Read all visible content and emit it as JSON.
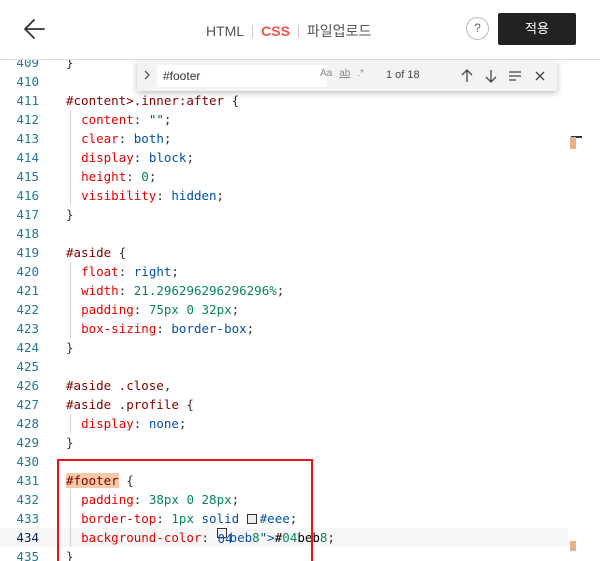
{
  "header": {
    "tabs": [
      {
        "label": "HTML",
        "active": false
      },
      {
        "label": "CSS",
        "active": true
      },
      {
        "label": "파일업로드",
        "active": false
      }
    ],
    "help_label": "?",
    "apply_label": "적용"
  },
  "find": {
    "query": "#footer",
    "opt_case": "Aa",
    "opt_word": "ab",
    "opt_regex": ".*",
    "count": "1 of 18"
  },
  "colors": {
    "active_tab": "#f0524a",
    "highlight_box": "#e8101a",
    "swatch_border": "#eeeeee",
    "swatch_bg": "#04beb8"
  },
  "lines": [
    {
      "n": "409",
      "text": "}"
    },
    {
      "n": "410",
      "text": ""
    },
    {
      "n": "411",
      "text": "#content>.inner:after {"
    },
    {
      "n": "412",
      "text": "  content: \"\";"
    },
    {
      "n": "413",
      "text": "  clear: both;"
    },
    {
      "n": "414",
      "text": "  display: block;"
    },
    {
      "n": "415",
      "text": "  height: 0;"
    },
    {
      "n": "416",
      "text": "  visibility: hidden;"
    },
    {
      "n": "417",
      "text": "}"
    },
    {
      "n": "418",
      "text": ""
    },
    {
      "n": "419",
      "text": "#aside {"
    },
    {
      "n": "420",
      "text": "  float: right;"
    },
    {
      "n": "421",
      "text": "  width: 21.296296296296296%;"
    },
    {
      "n": "422",
      "text": "  padding: 75px 0 32px;"
    },
    {
      "n": "423",
      "text": "  box-sizing: border-box;"
    },
    {
      "n": "424",
      "text": "}"
    },
    {
      "n": "425",
      "text": ""
    },
    {
      "n": "426",
      "text": "#aside .close,"
    },
    {
      "n": "427",
      "text": "#aside .profile {"
    },
    {
      "n": "428",
      "text": "  display: none;"
    },
    {
      "n": "429",
      "text": "}"
    },
    {
      "n": "430",
      "text": ""
    },
    {
      "n": "431",
      "text": "#footer {"
    },
    {
      "n": "432",
      "text": "  padding: 38px 0 28px;"
    },
    {
      "n": "433",
      "text": "  border-top: 1px solid #eee;"
    },
    {
      "n": "434",
      "text": "  background-color: #04beb8;"
    },
    {
      "n": "435",
      "text": "}"
    }
  ]
}
